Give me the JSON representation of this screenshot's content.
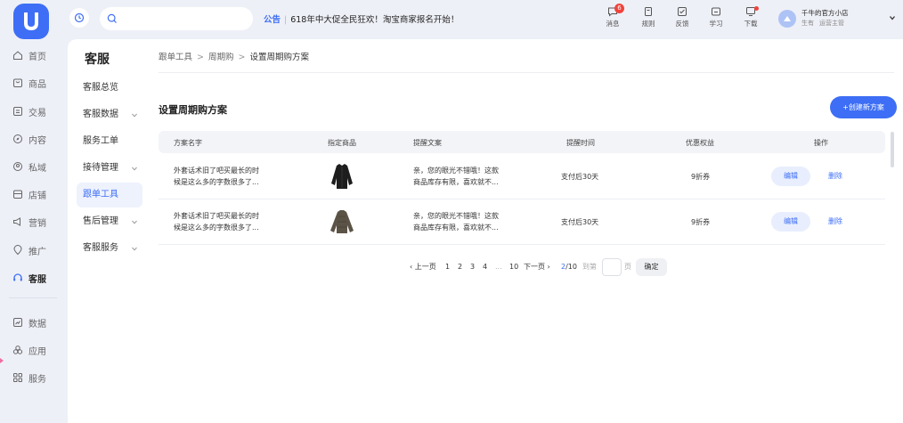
{
  "rail": {
    "items": [
      {
        "label": "首页",
        "icon": "home-icon"
      },
      {
        "label": "商品",
        "icon": "bag-icon"
      },
      {
        "label": "交易",
        "icon": "receipt-icon"
      },
      {
        "label": "内容",
        "icon": "compass-icon"
      },
      {
        "label": "私域",
        "icon": "people-icon"
      },
      {
        "label": "店铺",
        "icon": "store-icon"
      },
      {
        "label": "营销",
        "icon": "megaphone-icon"
      },
      {
        "label": "推广",
        "icon": "location-icon"
      },
      {
        "label": "客服",
        "icon": "headset-icon"
      },
      {
        "label": "数据",
        "icon": "chart-icon"
      },
      {
        "label": "应用",
        "icon": "apps-icon"
      },
      {
        "label": "服务",
        "icon": "grid-icon"
      }
    ]
  },
  "header": {
    "notice_tag": "公告",
    "notice_text": "618年中大促全民狂欢！淘宝商家报名开始！",
    "tools": [
      {
        "label": "消息",
        "icon": "message-icon",
        "badge": "6"
      },
      {
        "label": "规则",
        "icon": "rules-icon"
      },
      {
        "label": "反馈",
        "icon": "feedback-icon"
      },
      {
        "label": "学习",
        "icon": "study-icon"
      },
      {
        "label": "下载",
        "icon": "download-icon",
        "dot": true
      }
    ],
    "user_name": "千牛的官方小店",
    "user_role_a": "生有",
    "user_role_b": "运营主管"
  },
  "subnav": {
    "title": "客服",
    "items": [
      {
        "label": "客服总览",
        "expandable": false
      },
      {
        "label": "客服数据",
        "expandable": true
      },
      {
        "label": "服务工单",
        "expandable": false
      },
      {
        "label": "接待管理",
        "expandable": true
      },
      {
        "label": "跟单工具",
        "expandable": false,
        "active": true
      },
      {
        "label": "售后管理",
        "expandable": true
      },
      {
        "label": "客服服务",
        "expandable": true
      }
    ]
  },
  "breadcrumb": [
    "跟单工具",
    "周期购",
    "设置周期购方案"
  ],
  "page": {
    "title": "设置周期购方案",
    "create_button": "+创建新方案"
  },
  "table": {
    "headers": [
      "方案名字",
      "指定商品",
      "提醒文案",
      "提醒时间",
      "优惠权益",
      "操作"
    ],
    "rows": [
      {
        "name_line1": "外套话术旧了吧买最长的时",
        "name_line2": "候是这么多的字数很多了...",
        "product": "jacket-black-image",
        "copy_line1": "亲，您的眼光不错哦！这款",
        "copy_line2": "商品库存有限，喜欢就不...",
        "time": "支付后30天",
        "benefit": "9折券",
        "edit": "编辑",
        "delete": "删除"
      },
      {
        "name_line1": "外套话术旧了吧买最长的时",
        "name_line2": "候是这么多的字数很多了...",
        "product": "jacket-brown-image",
        "copy_line1": "亲，您的眼光不错哦！这款",
        "copy_line2": "商品库存有限，喜欢就不...",
        "time": "支付后30天",
        "benefit": "9折券",
        "edit": "编辑",
        "delete": "删除"
      }
    ]
  },
  "pagination": {
    "prev": "上一页",
    "pages": [
      "1",
      "2",
      "3",
      "4"
    ],
    "ellipsis": "...",
    "last": "10",
    "next": "下一页",
    "current": "2",
    "total": "/10",
    "jump_label": "到第",
    "page_unit": "页",
    "confirm": "确定"
  },
  "colors": {
    "accent": "#3d6ef5",
    "badge": "#f0433b",
    "page_bg": "#eef0f7"
  }
}
